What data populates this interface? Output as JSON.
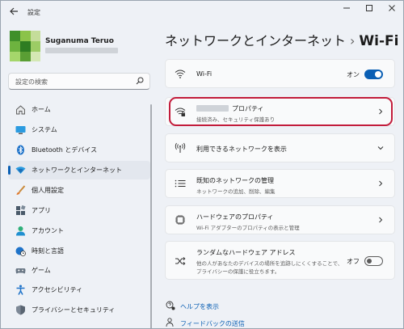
{
  "app_title": "設定",
  "user": {
    "name": "Suganuma Teruo"
  },
  "search": {
    "placeholder": "設定の検索"
  },
  "sidebar": {
    "items": [
      {
        "label": "ホーム",
        "icon": "home-icon"
      },
      {
        "label": "システム",
        "icon": "system-icon"
      },
      {
        "label": "Bluetooth とデバイス",
        "icon": "bluetooth-icon"
      },
      {
        "label": "ネットワークとインターネット",
        "icon": "network-icon",
        "selected": true
      },
      {
        "label": "個人用設定",
        "icon": "personalization-icon"
      },
      {
        "label": "アプリ",
        "icon": "apps-icon"
      },
      {
        "label": "アカウント",
        "icon": "accounts-icon"
      },
      {
        "label": "時刻と言語",
        "icon": "time-language-icon"
      },
      {
        "label": "ゲーム",
        "icon": "gaming-icon"
      },
      {
        "label": "アクセシビリティ",
        "icon": "accessibility-icon"
      },
      {
        "label": "プライバシーとセキュリティ",
        "icon": "privacy-icon"
      }
    ]
  },
  "breadcrumb": {
    "parent": "ネットワークとインターネット",
    "separator": "›",
    "current": "Wi-Fi"
  },
  "cards": {
    "wifi": {
      "title": "Wi-Fi",
      "toggle_label": "オン",
      "toggle_on": true
    },
    "properties": {
      "title": "プロパティ",
      "subtitle": "接続済み、セキュリティ保護あり"
    },
    "available": {
      "title": "利用できるネットワークを表示"
    },
    "known": {
      "title": "既知のネットワークの管理",
      "subtitle": "ネットワークの追加、削除、編集"
    },
    "hardware": {
      "title": "ハードウェアのプロパティ",
      "subtitle": "Wi-Fi アダプターのプロパティの表示と管理"
    },
    "random": {
      "title": "ランダムなハードウェア アドレス",
      "subtitle_line1": "他の人があなたのデバイスの場所を追跡しにくくすることで、",
      "subtitle_line2": "プライバシーの保護に役立ちます。",
      "toggle_label": "オフ",
      "toggle_on": false
    }
  },
  "links": {
    "help": "ヘルプを表示",
    "feedback": "フィードバックの送信"
  },
  "colors": {
    "accent": "#0a5fb4",
    "highlight": "#c21c3b"
  }
}
